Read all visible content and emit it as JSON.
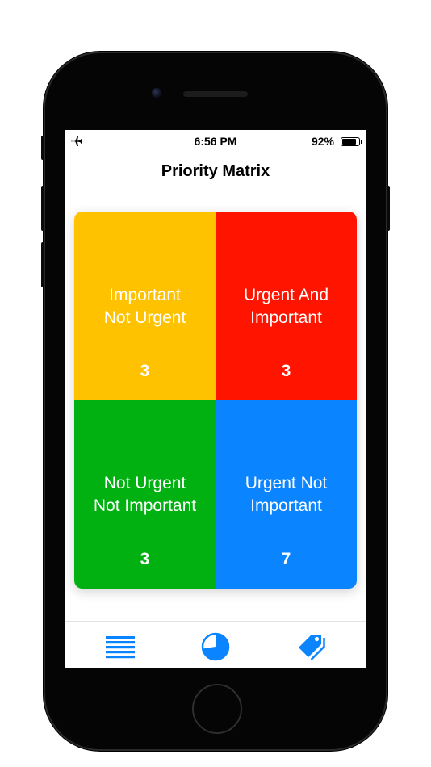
{
  "status_bar": {
    "time": "6:56 PM",
    "battery_percent": "92%",
    "battery_level": 0.92,
    "airplane_icon": "airplane-icon"
  },
  "nav": {
    "title": "Priority Matrix"
  },
  "matrix": {
    "quadrants": [
      {
        "label": "Important\nNot Urgent",
        "count": "3",
        "color": "#FFC200"
      },
      {
        "label": "Urgent And\nImportant",
        "count": "3",
        "color": "#FF1400"
      },
      {
        "label": "Not Urgent\nNot Important",
        "count": "3",
        "color": "#00B111"
      },
      {
        "label": "Urgent Not\nImportant",
        "count": "7",
        "color": "#0A84FF"
      }
    ]
  },
  "tab_bar": {
    "accent": "#0A84FF",
    "tabs": [
      {
        "icon": "list-icon"
      },
      {
        "icon": "pie-chart-icon"
      },
      {
        "icon": "tags-icon"
      }
    ]
  }
}
